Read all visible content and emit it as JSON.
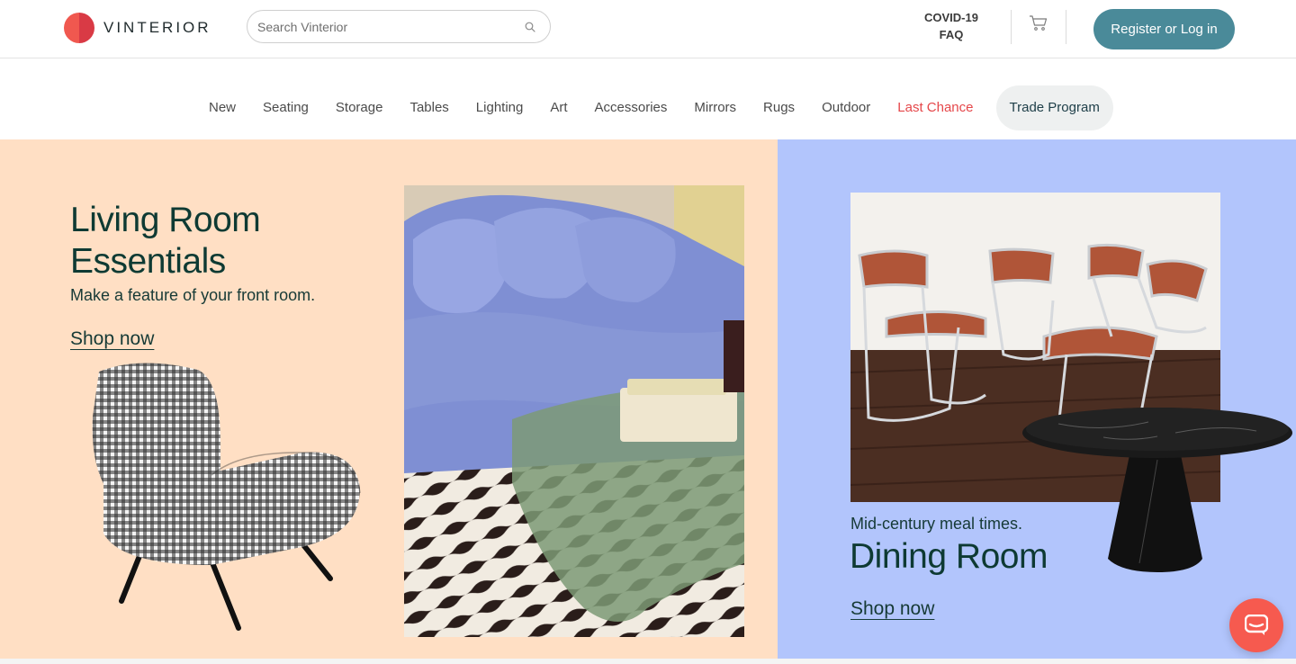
{
  "header": {
    "logo_text": "VINTERIOR",
    "search": {
      "placeholder": "Search Vinterior",
      "value": ""
    },
    "covid_faq": {
      "line1": "COVID-19",
      "line2": "FAQ"
    },
    "register_label": "Register or Log in"
  },
  "nav": {
    "items": [
      {
        "label": "New"
      },
      {
        "label": "Seating"
      },
      {
        "label": "Storage"
      },
      {
        "label": "Tables"
      },
      {
        "label": "Lighting"
      },
      {
        "label": "Art"
      },
      {
        "label": "Accessories"
      },
      {
        "label": "Mirrors"
      },
      {
        "label": "Rugs"
      },
      {
        "label": "Outdoor"
      },
      {
        "label": "Last Chance"
      },
      {
        "label": "Trade Program"
      }
    ]
  },
  "hero": {
    "living_room": {
      "title_line1": "Living Room",
      "title_line2": "Essentials",
      "subtitle": "Make a feature of your front room.",
      "cta": "Shop now"
    },
    "dining_room": {
      "subtitle": "Mid-century meal times.",
      "title": "Dining Room",
      "cta": "Shop now"
    }
  },
  "colors": {
    "brand_red": "#f0584f",
    "register_button": "#4a8a99",
    "sale_link": "#e5474a",
    "living_room_bg": "#ffdfc4",
    "dining_room_bg": "#b2c5fc",
    "heading": "#0e3a33",
    "chat_button": "#f65a4f"
  },
  "icons": {
    "search": "search-icon",
    "cart": "cart-icon",
    "chat": "chat-icon"
  }
}
